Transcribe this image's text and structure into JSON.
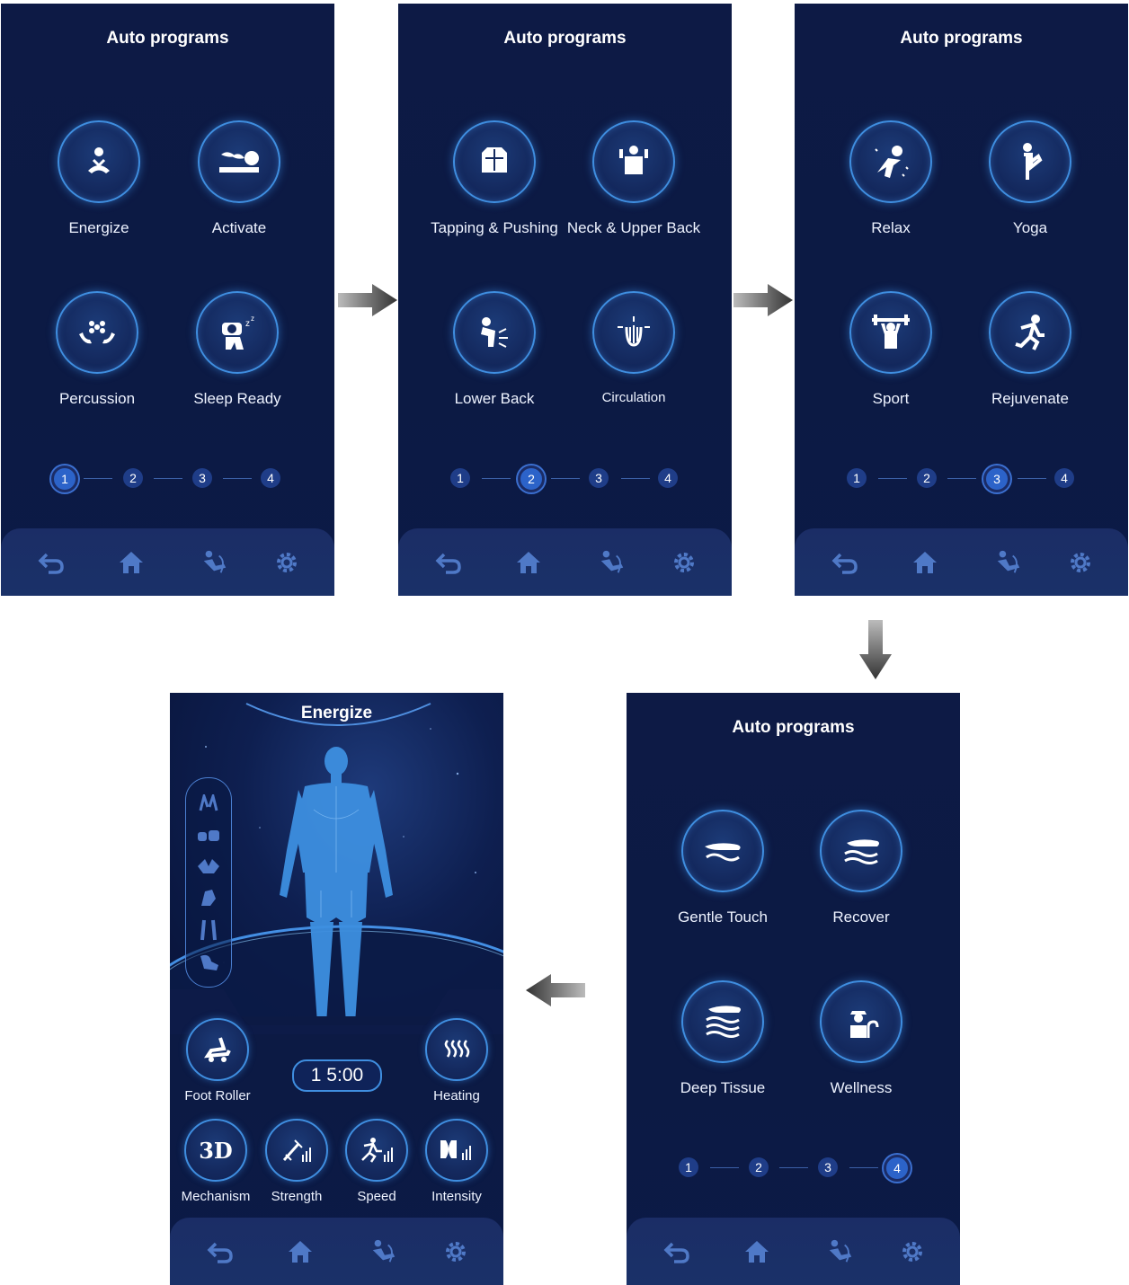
{
  "screens": [
    {
      "title": "Auto programs",
      "programs": [
        "Energize",
        "Activate",
        "Percussion",
        "Sleep Ready"
      ],
      "pages": [
        "1",
        "2",
        "3",
        "4"
      ],
      "active_page": 1
    },
    {
      "title": "Auto programs",
      "programs": [
        "Tapping & Pushing",
        "Neck & Upper Back",
        "Lower Back",
        "Circulation"
      ],
      "pages": [
        "1",
        "2",
        "3",
        "4"
      ],
      "active_page": 2
    },
    {
      "title": "Auto programs",
      "programs": [
        "Relax",
        "Yoga",
        "Sport",
        "Rejuvenate"
      ],
      "pages": [
        "1",
        "2",
        "3",
        "4"
      ],
      "active_page": 3
    },
    {
      "title": "Auto programs",
      "programs": [
        "Gentle Touch",
        "Recover",
        "Deep Tissue",
        "Wellness"
      ],
      "pages": [
        "1",
        "2",
        "3",
        "4"
      ],
      "active_page": 4
    }
  ],
  "detail": {
    "title": "Energize",
    "timer": "1 5:00",
    "controls": {
      "foot_roller": "Foot Roller",
      "heating": "Heating",
      "mechanism": "Mechanism",
      "mechanism_icon_text": "3D",
      "strength": "Strength",
      "speed": "Speed",
      "intensity": "Intensity"
    }
  },
  "nav_icons": [
    "back-icon",
    "home-icon",
    "massage-chair-icon",
    "settings-icon"
  ],
  "colors": {
    "background": "#0c1a44",
    "accent": "#3f8ee0",
    "active_page": "#2c63c9",
    "nav_icon": "#4f79c7"
  }
}
